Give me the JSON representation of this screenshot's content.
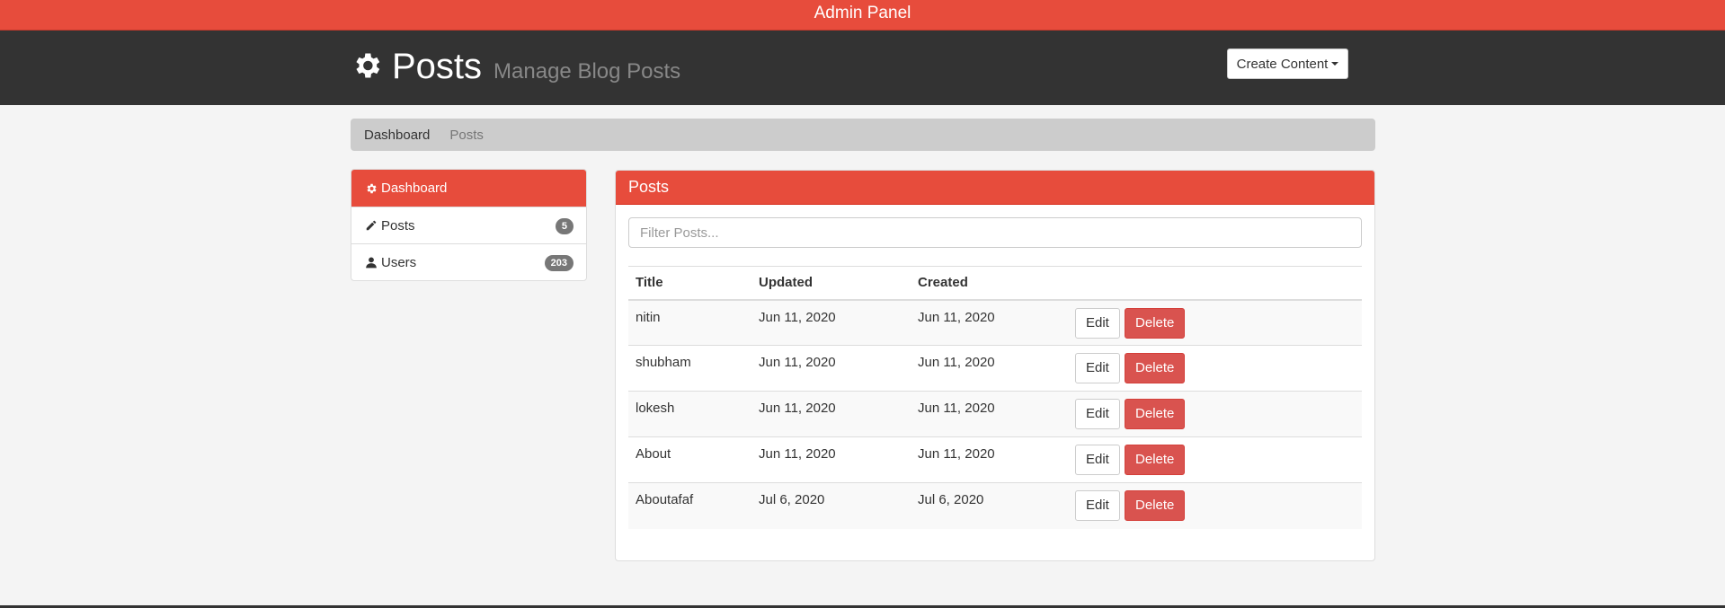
{
  "topbar": {
    "title": "Admin Panel"
  },
  "header": {
    "title": "Posts",
    "subtitle": "Manage Blog Posts",
    "icon": "gear-icon",
    "create_button": "Create Content"
  },
  "breadcrumb": {
    "items": [
      "Dashboard",
      "Posts"
    ]
  },
  "sidebar": {
    "items": [
      {
        "label": "Dashboard",
        "icon": "gear-icon",
        "badge": null
      },
      {
        "label": "Posts",
        "icon": "pencil-icon",
        "badge": "5"
      },
      {
        "label": "Users",
        "icon": "user-icon",
        "badge": "203"
      }
    ]
  },
  "panel": {
    "heading": "Posts",
    "filter_placeholder": "Filter Posts...",
    "columns": [
      "Title",
      "Updated",
      "Created",
      ""
    ],
    "rows": [
      {
        "title": "nitin",
        "updated": "Jun 11, 2020",
        "created": "Jun 11, 2020"
      },
      {
        "title": "shubham",
        "updated": "Jun 11, 2020",
        "created": "Jun 11, 2020"
      },
      {
        "title": "lokesh",
        "updated": "Jun 11, 2020",
        "created": "Jun 11, 2020"
      },
      {
        "title": "About",
        "updated": "Jun 11, 2020",
        "created": "Jun 11, 2020"
      },
      {
        "title": "Aboutafaf",
        "updated": "Jul 6, 2020",
        "created": "Jul 6, 2020"
      }
    ],
    "edit_label": "Edit",
    "delete_label": "Delete"
  },
  "colors": {
    "accent": "#e74c3c",
    "header": "#333333",
    "danger": "#d9534f"
  }
}
